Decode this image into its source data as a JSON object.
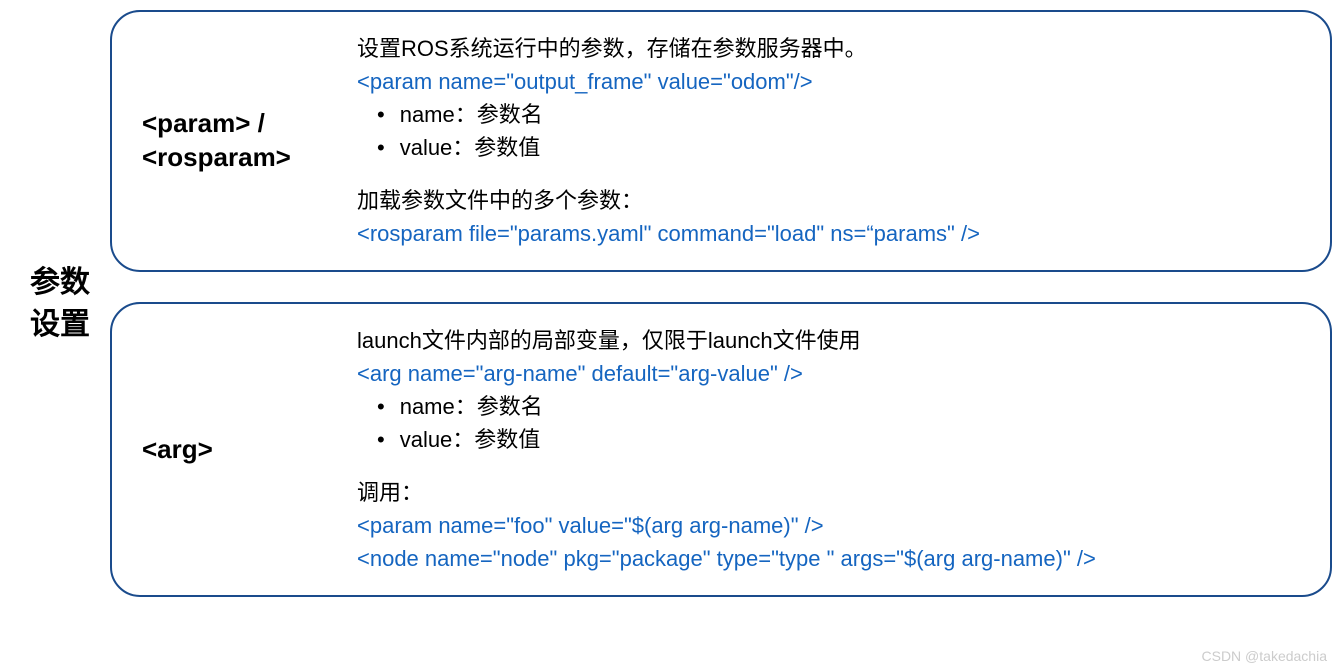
{
  "sideLabel": "参数设置",
  "box1": {
    "tag": "<param> / <rosparam>",
    "desc1": "设置ROS系统运行中的参数，存储在参数服务器中。",
    "code1": "<param name=\"output_frame\" value=\"odom\"/>",
    "bullets": [
      "name：参数名",
      "value：参数值"
    ],
    "desc2": "加载参数文件中的多个参数：",
    "code2": "<rosparam file=\"params.yaml\" command=\"load\" ns=“params\" />"
  },
  "box2": {
    "tag": "<arg>",
    "desc1": "launch文件内部的局部变量，仅限于launch文件使用",
    "code1": "<arg name=\"arg-name\"  default=\"arg-value\" />",
    "bullets": [
      "name：参数名",
      "value：参数值"
    ],
    "desc2": "调用：",
    "code2": "<param name=\"foo\" value=\"$(arg arg-name)\" />",
    "code3": "<node name=\"node\" pkg=\"package\" type=\"type \" args=\"$(arg arg-name)\" />"
  },
  "watermark": "CSDN @takedachia"
}
